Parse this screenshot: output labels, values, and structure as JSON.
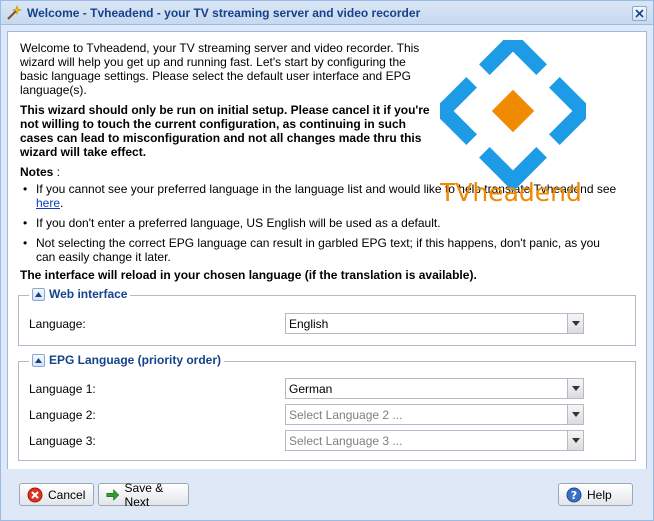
{
  "window": {
    "title": "Welcome - Tvheadend - your TV streaming server and video recorder"
  },
  "intro": "Welcome to Tvheadend, your TV streaming server and video recorder. This wizard will help you get up and running fast. Let's start by configuring the basic language settings. Please select the default user interface and EPG language(s).",
  "warning": "This wizard should only be run on initial setup. Please cancel it if you're not willing to touch the current configuration, as continuing in such cases can lead to misconfiguration and not all changes made thru this wizard will take effect.",
  "notes": {
    "title": "Notes",
    "colon": " :",
    "item1_text": "If you cannot see your preferred language in the language list and would like to help translate Tvheadend see ",
    "item1_link": "here",
    "item1_end": ".",
    "item2": "If you don't enter a preferred language, US English will be used as a default.",
    "item3": "Not selecting the correct EPG language can result in garbled EPG text; if this happens, don't panic, as you can easily change it later."
  },
  "reload": "The interface will reload in your chosen language (if the translation is available).",
  "logo": {
    "text": "TVheadend",
    "colors": {
      "blue": "#1e9be6",
      "orange": "#f08a00"
    }
  },
  "web_interface": {
    "legend": "Web interface",
    "language_label": "Language:",
    "language_value": "English"
  },
  "epg": {
    "legend": "EPG Language (priority order)",
    "lang1_label": "Language 1:",
    "lang1_value": "German",
    "lang2_label": "Language 2:",
    "lang2_placeholder": "Select Language 2 ...",
    "lang3_label": "Language 3:",
    "lang3_placeholder": "Select Language 3 ..."
  },
  "buttons": {
    "cancel": "Cancel",
    "save_next": "Save & Next",
    "help": "Help"
  }
}
